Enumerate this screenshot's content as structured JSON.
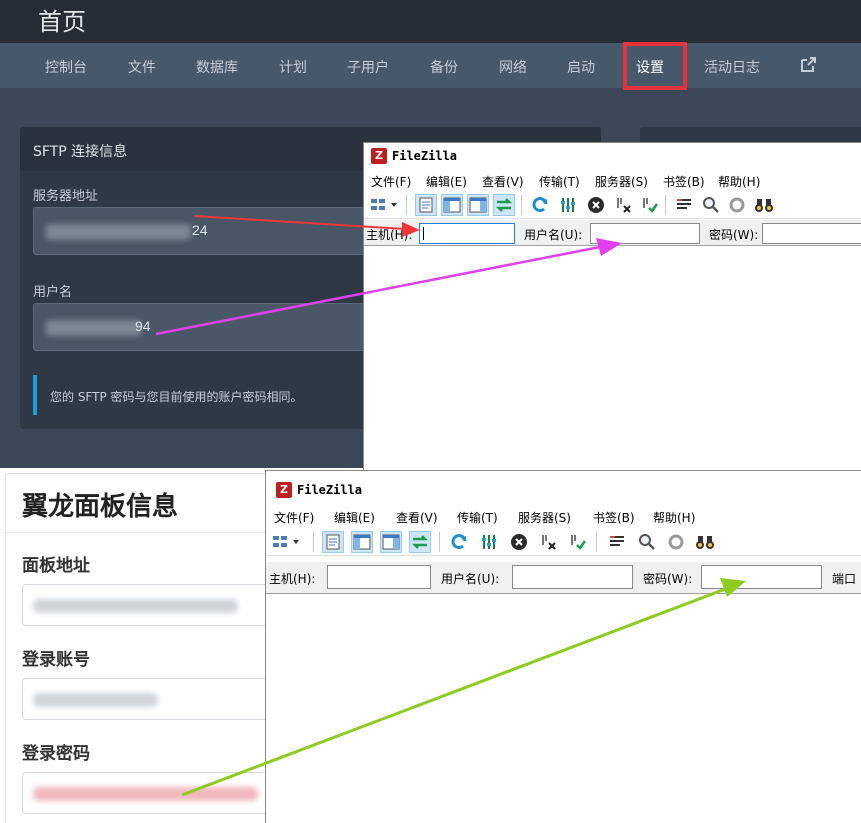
{
  "top_panel": {
    "title": "首页",
    "nav": [
      "控制台",
      "文件",
      "数据库",
      "计划",
      "子用户",
      "备份",
      "网络",
      "启动",
      "设置",
      "活动日志"
    ],
    "active_nav": "设置",
    "sftp": {
      "card_title": "SFTP 连接信息",
      "server_label": "服务器地址",
      "server_value_tail": "24",
      "user_label": "用户名",
      "user_value_tail": "94",
      "note": "您的 SFTP 密码与您目前使用的账户密码相同。"
    }
  },
  "panel_info": {
    "title": "翼龙面板信息",
    "panel_url_label": "面板地址",
    "login_account_label": "登录账号",
    "login_password_label": "登录密码"
  },
  "filezilla_top": {
    "title": "FileZilla",
    "menu": [
      "文件(F)",
      "编辑(E)",
      "查看(V)",
      "传输(T)",
      "服务器(S)",
      "书签(B)",
      "帮助(H)"
    ],
    "host_label": "主机(H):",
    "user_label": "用户名(U):",
    "password_label": "密码(W):"
  },
  "filezilla_bottom": {
    "title": "FileZilla",
    "menu": [
      "文件(F)",
      "编辑(E)",
      "查看(V)",
      "传输(T)",
      "服务器(S)",
      "书签(B)",
      "帮助(H)"
    ],
    "host_label": "主机(H):",
    "user_label": "用户名(U):",
    "password_label": "密码(W):",
    "port_label": "端口"
  },
  "colors": {
    "highlight_box": "#e6323a",
    "arrow_red": "#f0383c",
    "arrow_magenta": "#e040f0",
    "arrow_green": "#8ccc1e",
    "note_accent": "#1aa0d6"
  }
}
